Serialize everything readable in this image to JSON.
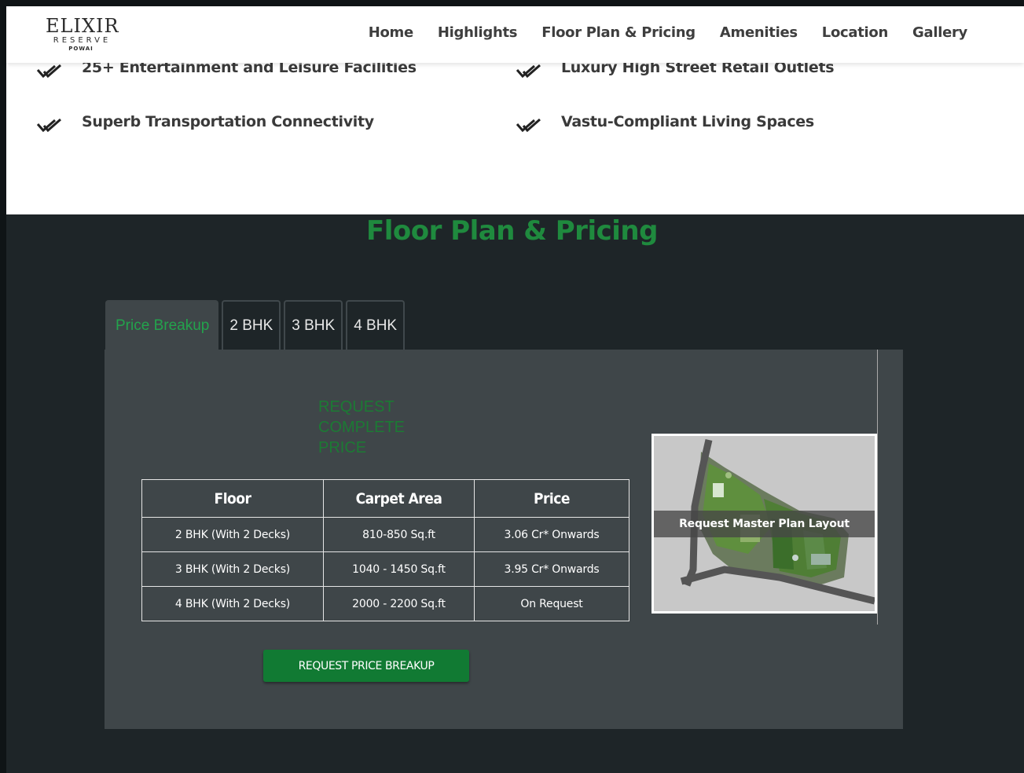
{
  "header": {
    "logo": {
      "line1": "ELIXIR",
      "line2": "RESERVE",
      "line3": "POWAI"
    },
    "nav": [
      "Home",
      "Highlights",
      "Floor Plan & Pricing",
      "Amenities",
      "Location",
      "Gallery"
    ]
  },
  "highlights": [
    "25+ Entertainment and Leisure Facilities",
    "Luxury High Street Retail Outlets",
    "Superb Transportation Connectivity",
    "Vastu-Compliant Living Spaces"
  ],
  "pricing": {
    "title": "Floor Plan & Pricing",
    "tabs": [
      "Price Breakup",
      "2 BHK",
      "3 BHK",
      "4 BHK"
    ],
    "active_tab": "Price Breakup",
    "request_text": "REQUEST COMPLETE PRICE",
    "table": {
      "headers": [
        "Floor",
        "Carpet Area",
        "Price"
      ],
      "rows": [
        [
          "2 BHK (With 2 Decks)",
          "810-850 Sq.ft",
          "3.06 Cr* Onwards"
        ],
        [
          "3 BHK (With 2 Decks)",
          "1040 - 1450 Sq.ft",
          "3.95 Cr* Onwards"
        ],
        [
          "4 BHK (With 2 Decks)",
          "2000 - 2200 Sq.ft",
          "On Request"
        ]
      ]
    },
    "button_label": "REQUEST PRICE BREAKUP",
    "master_plan_label": "Request Master Plan Layout"
  },
  "colors": {
    "accent_green": "#1f8a3e",
    "button_green": "#117a33",
    "panel": "#3f4649",
    "background": "#1e2528"
  }
}
